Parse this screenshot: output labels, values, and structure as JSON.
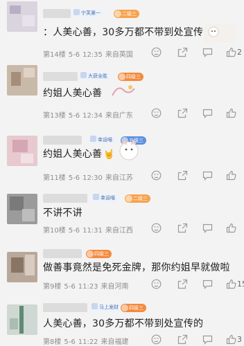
{
  "comments": [
    {
      "user_badge": "宁芙第一",
      "level_badge": "二级三",
      "level_color": "#f7a24a",
      "text": "：人美心善，30多万都不带到处宣传的",
      "floor": "第14楼",
      "date": "5-6",
      "time": "12:35",
      "location": "来自英国",
      "likes": "2",
      "sticker_text": "Ai 以你"
    },
    {
      "user_badge": "大获全胜",
      "level_badge": "四级三",
      "level_color": "#f48a3c",
      "text": "约姐人美心善",
      "floor": "第13楼",
      "date": "5-6",
      "time": "12:34",
      "location": "来自广东",
      "likes": ""
    },
    {
      "user_badge": "幸运喵",
      "level_badge": "五级三",
      "level_color": "#5f8fe0",
      "text": "约姐人美心善",
      "emoji": "🤘",
      "floor": "第11楼",
      "date": "5-6",
      "time": "12:30",
      "location": "来自江苏",
      "likes": ""
    },
    {
      "user_badge": "幸运喵",
      "level_badge": "二级三",
      "level_color": "#f7a24a",
      "text": "不讲不讲",
      "floor": "第10楼",
      "date": "5-6",
      "time": "11:31",
      "location": "来自江西",
      "likes": ""
    },
    {
      "user_badge": "",
      "level_badge": "四级三",
      "level_color": "#f48a3c",
      "text": "做善事竟然是免死金牌，那你约姐早就做啦",
      "floor": "第9楼",
      "date": "5-6",
      "time": "11:23",
      "location": "来自河南",
      "likes": "15"
    },
    {
      "user_badge": "马上发财",
      "level_badge": "四级三",
      "level_color": "#f48a3c",
      "text": "人美心善，30多万都不带到处宣传的",
      "floor": "第8楼",
      "date": "5-6",
      "time": "11:22",
      "location": "来自福建",
      "likes": "3"
    }
  ],
  "colors": {
    "background": "#f3f3f3",
    "meta_text": "#8d8d8d",
    "icon": "#9a9a9a"
  },
  "icons": [
    "dislike-icon",
    "share-icon",
    "comment-icon",
    "like-icon"
  ]
}
